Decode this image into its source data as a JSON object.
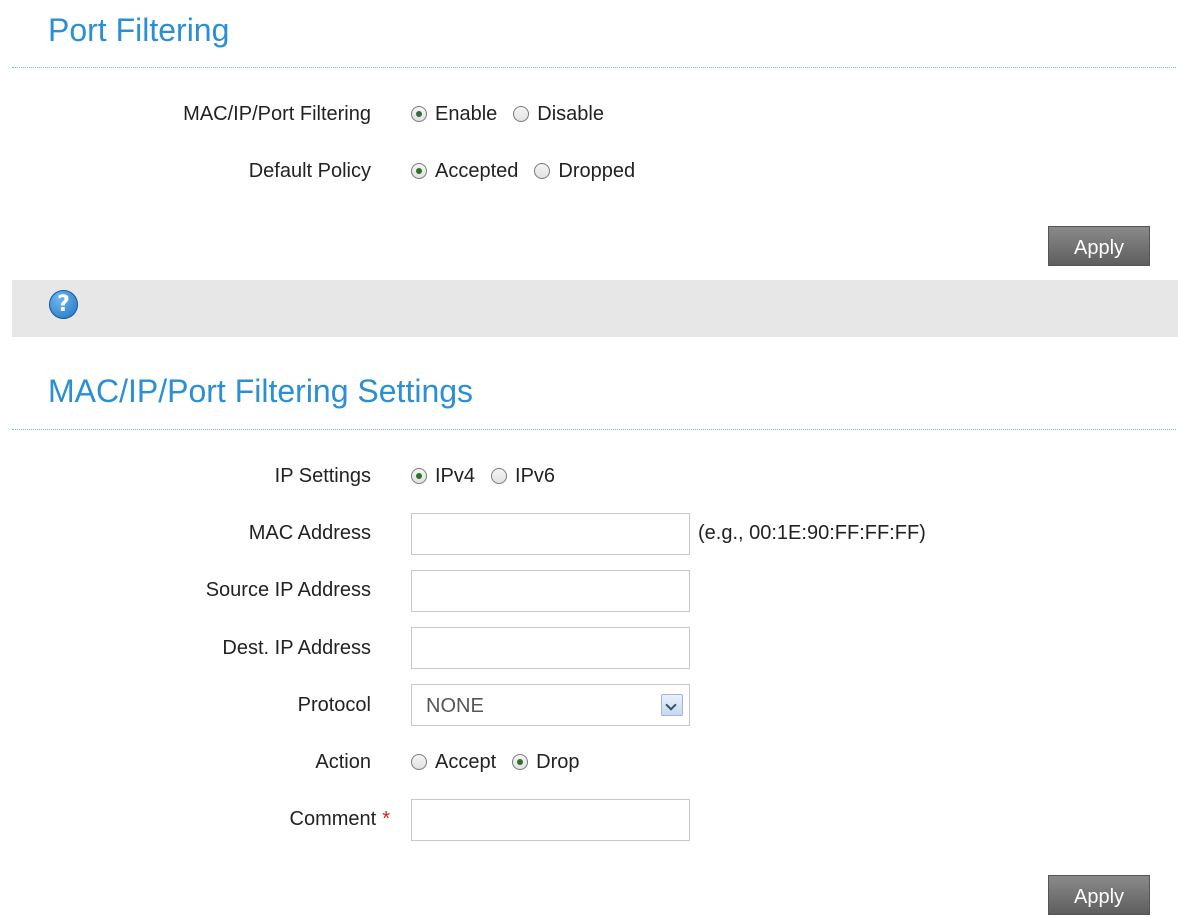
{
  "port_filtering": {
    "title": "Port Filtering",
    "filtering_label": "MAC/IP/Port Filtering",
    "filtering_options": [
      "Enable",
      "Disable"
    ],
    "filtering_selected": "Enable",
    "policy_label": "Default Policy",
    "policy_options": [
      "Accepted",
      "Dropped"
    ],
    "policy_selected": "Accepted",
    "apply_label": "Apply"
  },
  "help": {
    "icon_glyph": "?",
    "icon": "help-icon"
  },
  "settings": {
    "title": "MAC/IP/Port Filtering Settings",
    "ip_settings_label": "IP Settings",
    "ip_options": [
      "IPv4",
      "IPv6"
    ],
    "ip_selected": "IPv4",
    "mac_label": "MAC Address",
    "mac_value": "",
    "mac_hint": "(e.g., 00:1E:90:FF:FF:FF)",
    "source_ip_label": "Source IP Address",
    "source_ip_value": "",
    "dest_ip_label": "Dest. IP Address",
    "dest_ip_value": "",
    "protocol_label": "Protocol",
    "protocol_value": "NONE",
    "action_label": "Action",
    "action_options": [
      "Accept",
      "Drop"
    ],
    "action_selected": "Drop",
    "comment_label": "Comment",
    "comment_required": "*",
    "comment_value": "",
    "apply_label": "Apply"
  },
  "colors": {
    "title": "#2b8fd6",
    "help_bar": "#e7e7e7",
    "button": "#6f6f6f",
    "required": "#d0231b"
  }
}
